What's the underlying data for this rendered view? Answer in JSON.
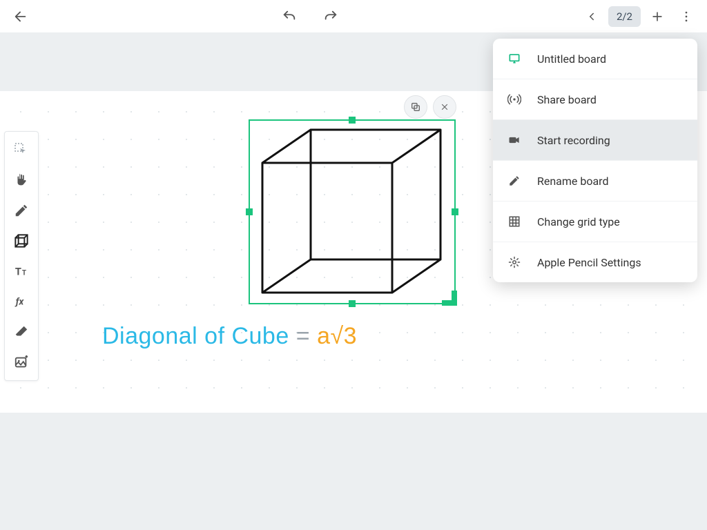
{
  "topbar": {
    "page_indicator": "2/2"
  },
  "equation": {
    "lhs": "Diagonal of Cube",
    "eq": "=",
    "rhs": "a√3"
  },
  "menu": {
    "items": [
      {
        "label": "Untitled board",
        "icon": "board-icon"
      },
      {
        "label": "Share board",
        "icon": "broadcast-icon"
      },
      {
        "label": "Start recording",
        "icon": "video-icon",
        "highlight": true
      },
      {
        "label": "Rename board",
        "icon": "pencil-icon"
      },
      {
        "label": "Change grid type",
        "icon": "grid-icon"
      },
      {
        "label": "Apple Pencil Settings",
        "icon": "gear-icon"
      }
    ]
  },
  "colors": {
    "selection": "#1BC47D",
    "text_blue": "#2BB9E6",
    "text_orange": "#F5A623"
  }
}
